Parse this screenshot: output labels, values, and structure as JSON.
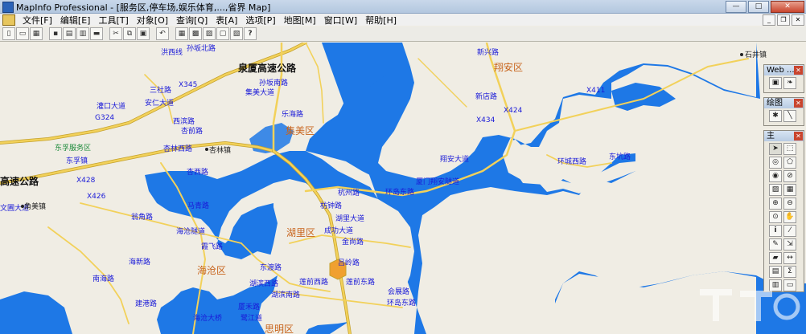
{
  "window": {
    "title": "MapInfo Professional - [服务区,停车场,娱乐体育,...,省界 Map]"
  },
  "menu": {
    "items": [
      "文件[F]",
      "编辑[E]",
      "工具[T]",
      "对象[O]",
      "查询[Q]",
      "表[A]",
      "选项[P]",
      "地图[M]",
      "窗口[W]",
      "帮助[H]"
    ]
  },
  "toolbar": {
    "help_label": "?"
  },
  "map": {
    "labels": [
      {
        "id": "l01",
        "text": "洪西线",
        "type": "road"
      },
      {
        "id": "l02",
        "text": "孙坂北路",
        "type": "road"
      },
      {
        "id": "l03",
        "text": "泉厦高速公路",
        "type": "highway"
      },
      {
        "id": "l04",
        "text": "孙坂南路",
        "type": "road"
      },
      {
        "id": "l05",
        "text": "X345",
        "type": "road"
      },
      {
        "id": "l06",
        "text": "三社路",
        "type": "road"
      },
      {
        "id": "l07",
        "text": "集美大道",
        "type": "road"
      },
      {
        "id": "l08",
        "text": "灌口大道",
        "type": "road"
      },
      {
        "id": "l09",
        "text": "安仁大道",
        "type": "road"
      },
      {
        "id": "l10",
        "text": "乐海路",
        "type": "road"
      },
      {
        "id": "l11",
        "text": "G324",
        "type": "road"
      },
      {
        "id": "l12",
        "text": "西滨路",
        "type": "road"
      },
      {
        "id": "l13",
        "text": "集美区",
        "type": "district"
      },
      {
        "id": "l14",
        "text": "杏前路",
        "type": "road"
      },
      {
        "id": "l15",
        "text": "东孚服务区",
        "type": "service"
      },
      {
        "id": "l16",
        "text": "杏林西路",
        "type": "road"
      },
      {
        "id": "l17",
        "text": "杏林镇",
        "type": "town"
      },
      {
        "id": "l18",
        "text": "东孚镇",
        "type": "town"
      },
      {
        "id": "l19",
        "text": "杏西路",
        "type": "road"
      },
      {
        "id": "l20",
        "text": "高速公路",
        "type": "highway"
      },
      {
        "id": "l21",
        "text": "X428",
        "type": "road"
      },
      {
        "id": "l22",
        "text": "X426",
        "type": "road"
      },
      {
        "id": "l23",
        "text": "文圃大道",
        "type": "road"
      },
      {
        "id": "l24",
        "text": "角美镇",
        "type": "town"
      },
      {
        "id": "l25",
        "text": "马青路",
        "type": "road"
      },
      {
        "id": "l26",
        "text": "翁角路",
        "type": "road"
      },
      {
        "id": "l27",
        "text": "海沧隧道",
        "type": "road"
      },
      {
        "id": "l28",
        "text": "霞飞路",
        "type": "road"
      },
      {
        "id": "l29",
        "text": "海新路",
        "type": "road"
      },
      {
        "id": "l30",
        "text": "南海路",
        "type": "road"
      },
      {
        "id": "l31",
        "text": "海沧区",
        "type": "district"
      },
      {
        "id": "l32",
        "text": "建港路",
        "type": "road"
      },
      {
        "id": "l33",
        "text": "海沧大桥",
        "type": "road"
      },
      {
        "id": "l34",
        "text": "东渡路",
        "type": "road"
      },
      {
        "id": "l35",
        "text": "湖滨西路",
        "type": "road"
      },
      {
        "id": "l36",
        "text": "湖滨南路",
        "type": "road"
      },
      {
        "id": "l37",
        "text": "厦禾路",
        "type": "road"
      },
      {
        "id": "l38",
        "text": "鹭江道",
        "type": "road"
      },
      {
        "id": "l39",
        "text": "思明区",
        "type": "district"
      },
      {
        "id": "l40",
        "text": "湖里区",
        "type": "district"
      },
      {
        "id": "l41",
        "text": "杭州路",
        "type": "road"
      },
      {
        "id": "l42",
        "text": "枋钟路",
        "type": "road"
      },
      {
        "id": "l43",
        "text": "湖里大道",
        "type": "road"
      },
      {
        "id": "l44",
        "text": "成功大道",
        "type": "road"
      },
      {
        "id": "l45",
        "text": "金尚路",
        "type": "road"
      },
      {
        "id": "l46",
        "text": "吕岭路",
        "type": "road"
      },
      {
        "id": "l47",
        "text": "莲前西路",
        "type": "road"
      },
      {
        "id": "l48",
        "text": "莲前东路",
        "type": "road"
      },
      {
        "id": "l49",
        "text": "会展路",
        "type": "road"
      },
      {
        "id": "l50",
        "text": "环岛东路",
        "type": "road"
      },
      {
        "id": "l51",
        "text": "环岛东路",
        "type": "road"
      },
      {
        "id": "l52",
        "text": "厦门翔安隧道",
        "type": "road"
      },
      {
        "id": "l53",
        "text": "翔安大道",
        "type": "road"
      },
      {
        "id": "l54",
        "text": "X434",
        "type": "road"
      },
      {
        "id": "l55",
        "text": "新兴路",
        "type": "road"
      },
      {
        "id": "l56",
        "text": "翔安区",
        "type": "district"
      },
      {
        "id": "l57",
        "text": "新店路",
        "type": "road"
      },
      {
        "id": "l58",
        "text": "X424",
        "type": "road"
      },
      {
        "id": "l59",
        "text": "X411",
        "type": "road"
      },
      {
        "id": "l60",
        "text": "环城西路",
        "type": "road"
      },
      {
        "id": "l61",
        "text": "东坑路",
        "type": "road"
      },
      {
        "id": "l62",
        "text": "石井镇",
        "type": "town"
      }
    ]
  },
  "palettes": {
    "web": {
      "title": "Web ..."
    },
    "drawing": {
      "title": "绘图"
    },
    "main": {
      "title": "主",
      "info_glyph": "i",
      "sum_glyph": "Σ"
    }
  },
  "colors": {
    "water": "#1e78e6",
    "land": "#f0ede4",
    "road": "#f2d15a",
    "road_casing": "#c4a12c",
    "label_road": "#1a1ad8",
    "label_district": "#c8641c"
  }
}
